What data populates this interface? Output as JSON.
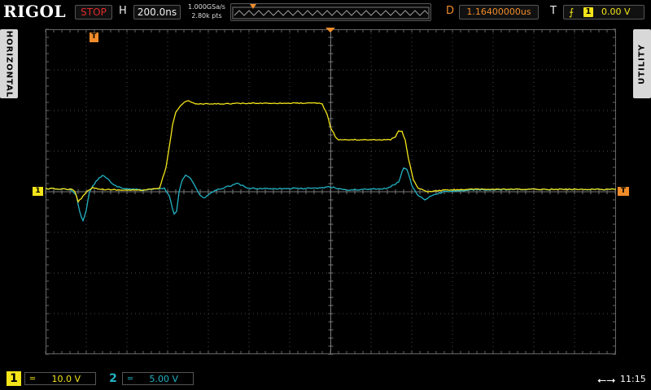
{
  "brand": "RIGOL",
  "top_bar": {
    "run_status": "STOP",
    "timebase_label": "H",
    "timebase": "200.0ns",
    "sample_rate": "1.000GSa/s",
    "memory_depth": "2.80k pts",
    "delay_label": "D",
    "delay": "1.16400000us",
    "trigger_label": "T",
    "trigger_edge": "rising-edge-icon",
    "trigger_source": "1",
    "trigger_level": "0.00 V"
  },
  "side_tabs": {
    "left": "HORIZONTAL",
    "right": "UTILITY"
  },
  "markers": {
    "ch1": "1",
    "trigger_level": "T",
    "trigger_position": "T"
  },
  "channels": [
    {
      "number": "1",
      "scale": "10.0 V",
      "color": "#f4e51a"
    },
    {
      "number": "2",
      "scale": "5.00 V",
      "color": "#22b3c4"
    }
  ],
  "bottom_bar": {
    "usb_icon": "usb-icon",
    "clock": "11:15"
  },
  "colors": {
    "grid": "#4a4a4a",
    "trigger": "#f08c2a",
    "stop": "#e02a2a"
  }
}
